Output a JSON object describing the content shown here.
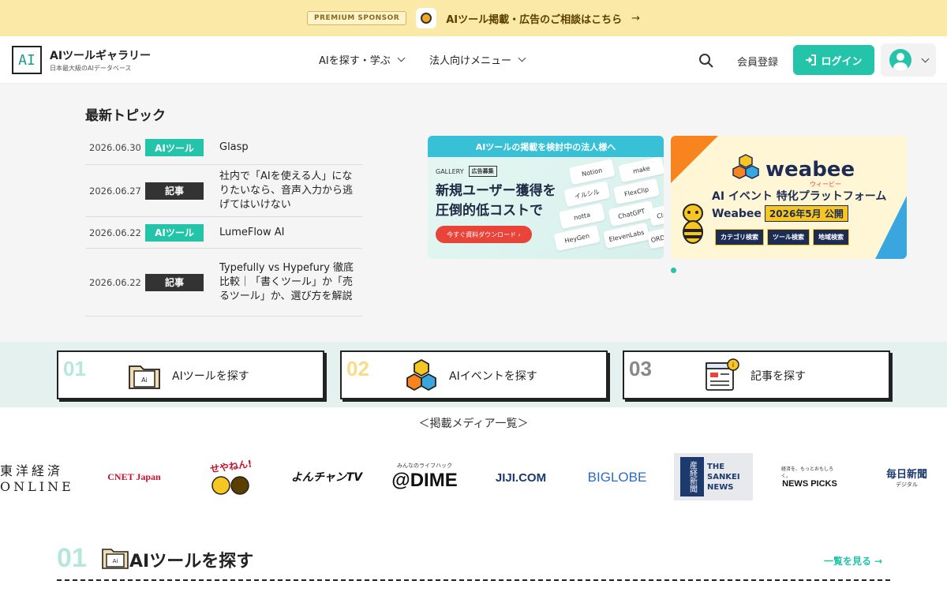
{
  "sponsor": {
    "badge": "PREMIUM SPONSOR",
    "text": "AIツール掲載・広告のご相談はこちら",
    "arrow": "→"
  },
  "header": {
    "logo_mark": "AI",
    "site_name": "AIツールギャラリー",
    "site_tagline": "日本最大級のAIデータベース",
    "nav": [
      {
        "label": "AIを探す・学ぶ"
      },
      {
        "label": "法人向けメニュー"
      }
    ],
    "register": "会員登録",
    "login": "ログイン"
  },
  "topics": {
    "title": "最新トピック",
    "items": [
      {
        "date": "2026.06.30",
        "tag": "AIツール",
        "type": "tool",
        "title": "Glasp"
      },
      {
        "date": "2026.06.27",
        "tag": "記事",
        "type": "article",
        "title": "社内で「AIを使える人」になりたいなら、音声入力から逃げてはいけない"
      },
      {
        "date": "2026.06.22",
        "tag": "AIツール",
        "type": "tool",
        "title": "LumeFlow AI"
      },
      {
        "date": "2026.06.22",
        "tag": "記事",
        "type": "article",
        "title": "Typefully vs Hypefury 徹底比較｜「書くツール」か「売るツール」か、選び方を解説"
      },
      {
        "date": "",
        "tag": "",
        "type": "tool",
        "title": ""
      }
    ]
  },
  "banner1": {
    "bar": "AIツールの掲載を検討中の法人様へ",
    "gallery": "GALLERY",
    "ad_badge": "広告募集",
    "headline_1": "新規ユーザー獲得を",
    "headline_2": "圧倒的低コストで",
    "cta": "今すぐ資料ダウンロード ›",
    "logos": [
      "Notion",
      "make",
      "イルシル",
      "FlexClip",
      "notta",
      "ChatGPT",
      "HeyGen",
      "ElevenLabs",
      "Cla",
      "ORDERS"
    ]
  },
  "banner2": {
    "brand": "weabee",
    "brand_kana": "ウィービー",
    "line1": "AI イベント 特化プラットフォーム",
    "line2_name": "Weabee",
    "line2_date": "2026年5月 公開",
    "buttons": [
      "カテゴリ検索",
      "ツール検索",
      "地域検索"
    ]
  },
  "categories": [
    {
      "num": "01",
      "label": "AIツールを探す",
      "color": "#b7e6db"
    },
    {
      "num": "02",
      "label": "AIイベントを探す",
      "color": "#f7dc8c"
    },
    {
      "num": "03",
      "label": "記事を探す",
      "color": "#888888"
    }
  ],
  "media": {
    "title": "＜掲載メディア一覧＞",
    "logos": [
      "東洋経済 ONLINE",
      "CNET Japan",
      "せやねん!",
      "よんチャンTV",
      "@DIME",
      "JIJI.COM",
      "BIGLOBE",
      "THE SANKEI NEWS",
      "NEWS PICKS",
      "毎日新聞"
    ],
    "logo_subs": {
      "dime": "みんなのライフハック",
      "newspicks": "経済を、もっとおもしろく。",
      "mainichi": "デジタル",
      "sankei_kanji": "産経新聞"
    }
  },
  "section1": {
    "num": "01",
    "title": "AIツールを探す",
    "see_all": "一覧を見る →"
  }
}
